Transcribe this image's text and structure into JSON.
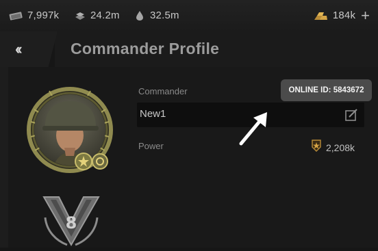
{
  "resources": [
    {
      "icon": "banknote-icon",
      "value": "7,997k"
    },
    {
      "icon": "steel-ingot-icon",
      "value": "24.2m"
    },
    {
      "icon": "fuel-drop-icon",
      "value": "32.5m"
    }
  ],
  "gold": {
    "icon": "gold-bars-icon",
    "value": "184k",
    "add_icon": "plus-icon"
  },
  "header": {
    "back_icon": "double-chevron-left-icon",
    "title": "Commander Profile"
  },
  "profile": {
    "commander_label": "Commander",
    "commander_name": "New1",
    "edit_icon": "edit-icon",
    "power_label": "Power",
    "power_icon": "power-star-icon",
    "power_value": "2,208k",
    "online_id_text": "ONLINE ID: 5843672"
  },
  "colors": {
    "accent_gold": "#b98c38",
    "badge": "#4b4b4b"
  }
}
